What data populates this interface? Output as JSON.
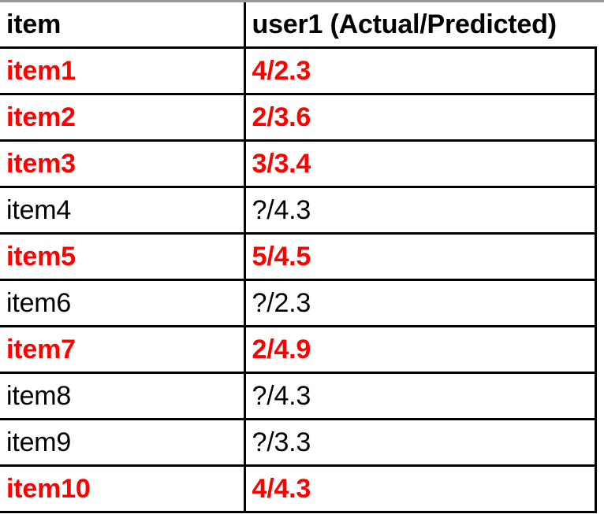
{
  "table": {
    "columns": [
      {
        "key": "item",
        "label": "item"
      },
      {
        "key": "value",
        "label": "user1 (Actual/Predicted)"
      }
    ],
    "rows": [
      {
        "item": "item1",
        "value": "4/2.3",
        "rated": true,
        "actual": 4,
        "predicted": 2.3
      },
      {
        "item": "item2",
        "value": "2/3.6",
        "rated": true,
        "actual": 2,
        "predicted": 3.6
      },
      {
        "item": "item3",
        "value": "3/3.4",
        "rated": true,
        "actual": 3,
        "predicted": 3.4
      },
      {
        "item": "item4",
        "value": "?/4.3",
        "rated": false,
        "actual": "?",
        "predicted": 4.3
      },
      {
        "item": "item5",
        "value": "5/4.5",
        "rated": true,
        "actual": 5,
        "predicted": 4.5
      },
      {
        "item": "item6",
        "value": "?/2.3",
        "rated": false,
        "actual": "?",
        "predicted": 2.3
      },
      {
        "item": "item7",
        "value": "2/4.9",
        "rated": true,
        "actual": 2,
        "predicted": 4.9
      },
      {
        "item": "item8",
        "value": "?/4.3",
        "rated": false,
        "actual": "?",
        "predicted": 4.3
      },
      {
        "item": "item9",
        "value": "?/3.3",
        "rated": false,
        "actual": "?",
        "predicted": 3.3
      },
      {
        "item": "item10",
        "value": "4/4.3",
        "rated": true,
        "actual": 4,
        "predicted": 4.3
      }
    ]
  },
  "colors": {
    "rated_text": "#FF0000",
    "unrated_text": "#000000",
    "header_text": "#000000",
    "grid_line": "#000000",
    "top_strip": "#999999",
    "background": "#FFFFFF"
  }
}
